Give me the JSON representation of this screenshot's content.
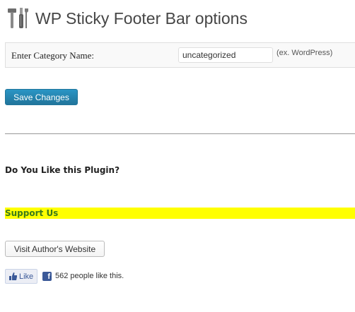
{
  "header": {
    "title": "WP Sticky Footer Bar options",
    "icon": "tools-icon"
  },
  "settings": {
    "category_label": "Enter Category Name:",
    "category_value": "uncategorized",
    "category_hint": "(ex. WordPress)"
  },
  "actions": {
    "save_label": "Save Changes"
  },
  "promo": {
    "question": "Do You Like this Plugin?",
    "support_text": "Support Us",
    "support_bg_color": "#ffff00",
    "support_text_color": "#3a7a1a",
    "visit_label": "Visit Author's Website"
  },
  "facebook": {
    "like_label": "Like",
    "like_icon": "thumb-up-icon",
    "fb_icon": "facebook-icon",
    "fb_glyph": "f",
    "count_text": "562 people like this."
  },
  "colors": {
    "primary_button": "#21759b",
    "facebook_blue": "#3b5998"
  }
}
